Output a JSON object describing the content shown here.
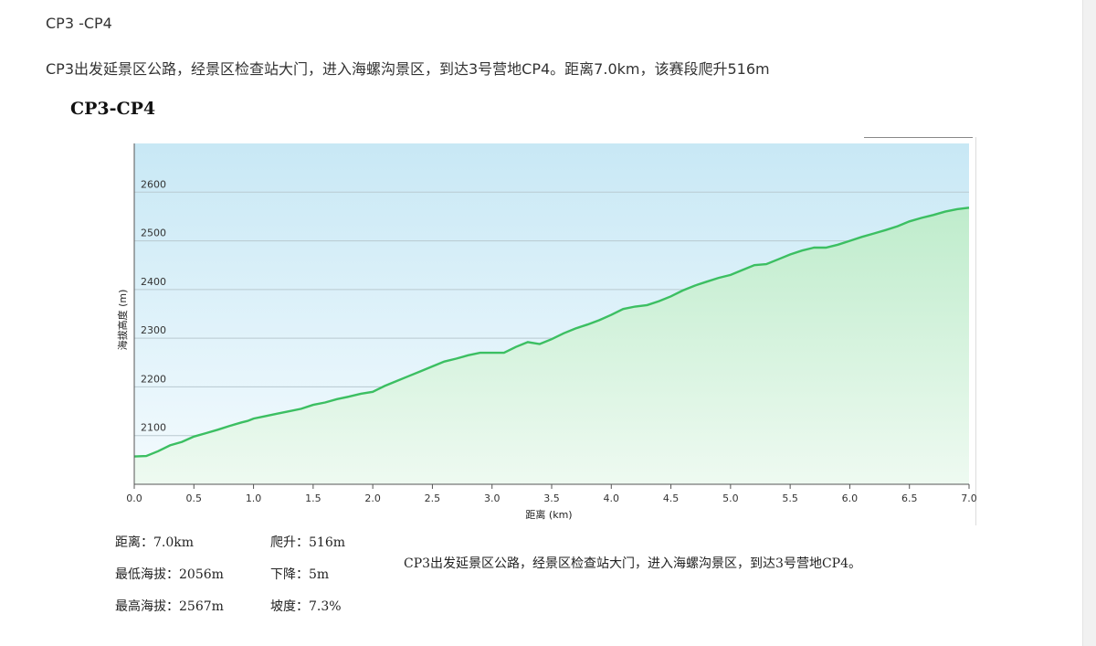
{
  "page": {
    "heading": "CP3 -CP4",
    "description": "CP3出发延景区公路，经景区检查站大门，进入海螺沟景区，到达3号营地CP4。距离7.0km，该赛段爬升516m"
  },
  "chart_data": {
    "type": "area",
    "title": "CP3-CP4",
    "xlabel": "距离 (km)",
    "ylabel": "海拔高度 (m)",
    "xlim": [
      0,
      7.0
    ],
    "ylim": [
      2000,
      2700
    ],
    "xticks": [
      "0.0",
      "0.5",
      "1.0",
      "1.5",
      "2.0",
      "2.5",
      "3.0",
      "3.5",
      "4.0",
      "4.5",
      "5.0",
      "5.5",
      "6.0",
      "6.5",
      "7.0"
    ],
    "yticks": [
      "2100",
      "2200",
      "2300",
      "2400",
      "2500",
      "2600"
    ],
    "grid": true,
    "series": [
      {
        "color": "#3cbf62",
        "x": [
          0.0,
          0.1,
          0.2,
          0.3,
          0.4,
          0.5,
          0.6,
          0.7,
          0.8,
          0.9,
          0.95,
          1.0,
          1.1,
          1.2,
          1.3,
          1.4,
          1.5,
          1.6,
          1.7,
          1.8,
          1.9,
          2.0,
          2.05,
          2.1,
          2.2,
          2.3,
          2.4,
          2.5,
          2.6,
          2.7,
          2.8,
          2.9,
          3.0,
          3.1,
          3.2,
          3.3,
          3.4,
          3.5,
          3.6,
          3.7,
          3.8,
          3.9,
          4.0,
          4.1,
          4.2,
          4.3,
          4.4,
          4.5,
          4.6,
          4.7,
          4.8,
          4.9,
          5.0,
          5.1,
          5.2,
          5.3,
          5.4,
          5.5,
          5.6,
          5.7,
          5.8,
          5.9,
          6.0,
          6.1,
          6.2,
          6.3,
          6.4,
          6.5,
          6.6,
          6.7,
          6.8,
          6.9,
          7.0
        ],
        "y": [
          2057,
          2058,
          2068,
          2080,
          2087,
          2098,
          2105,
          2112,
          2120,
          2127,
          2130,
          2135,
          2140,
          2145,
          2150,
          2155,
          2163,
          2168,
          2175,
          2180,
          2186,
          2190,
          2196,
          2202,
          2212,
          2222,
          2232,
          2242,
          2252,
          2258,
          2265,
          2270,
          2270,
          2270,
          2282,
          2292,
          2288,
          2298,
          2310,
          2320,
          2328,
          2337,
          2348,
          2360,
          2365,
          2368,
          2376,
          2386,
          2398,
          2408,
          2416,
          2424,
          2430,
          2440,
          2450,
          2452,
          2462,
          2472,
          2480,
          2486,
          2486,
          2492,
          2500,
          2508,
          2515,
          2522,
          2530,
          2540,
          2547,
          2553,
          2560,
          2565,
          2568
        ]
      }
    ]
  },
  "stats": {
    "distance": "距离：7.0km",
    "climb": "爬升：516m",
    "min_alt": "最低海拔：2056m",
    "descent": "下降：5m",
    "max_alt": "最高海拔：2567m",
    "slope": "坡度：7.3%",
    "note": "CP3出发延景区公路，经景区检查站大门，进入海螺沟景区，到达3号营地CP4。"
  }
}
